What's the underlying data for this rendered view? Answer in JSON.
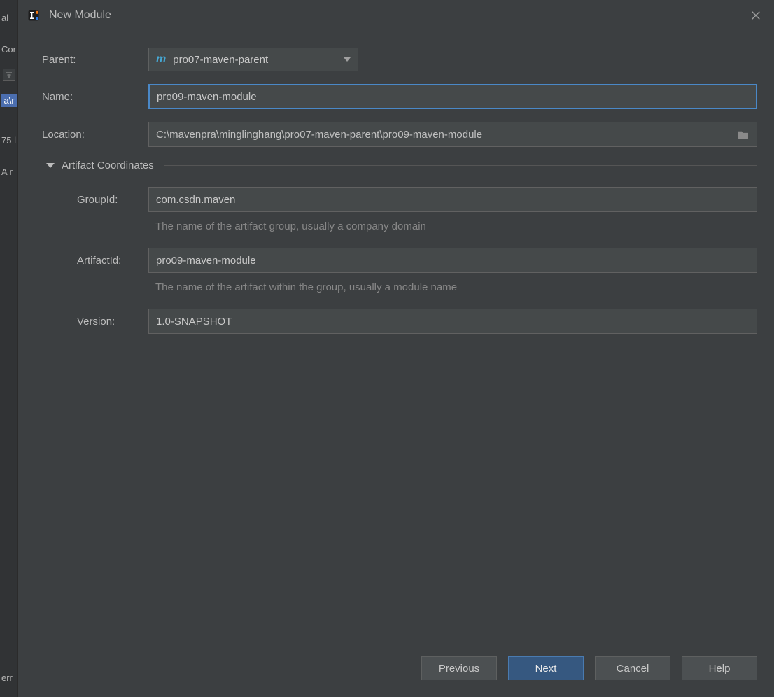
{
  "back": {
    "frag1": "al",
    "frag2": "Cor",
    "frag3": "a\\r",
    "frag4": "75 l",
    "frag5": "A r",
    "frag6": "err"
  },
  "dialog": {
    "title": "New Module"
  },
  "form": {
    "parent_label": "Parent:",
    "parent_value": "pro07-maven-parent",
    "name_label": "Name:",
    "name_value": "pro09-maven-module",
    "location_label": "Location:",
    "location_value": "C:\\mavenpra\\minglinghang\\pro07-maven-parent\\pro09-maven-module",
    "section_title": "Artifact Coordinates",
    "groupid_label": "GroupId:",
    "groupid_value": "com.csdn.maven",
    "groupid_hint": "The name of the artifact group, usually a company domain",
    "artifactid_label": "ArtifactId:",
    "artifactid_value": "pro09-maven-module",
    "artifactid_hint": "The name of the artifact within the group, usually a module name",
    "version_label": "Version:",
    "version_value": "1.0-SNAPSHOT"
  },
  "buttons": {
    "previous": "Previous",
    "next": "Next",
    "cancel": "Cancel",
    "help": "Help"
  }
}
